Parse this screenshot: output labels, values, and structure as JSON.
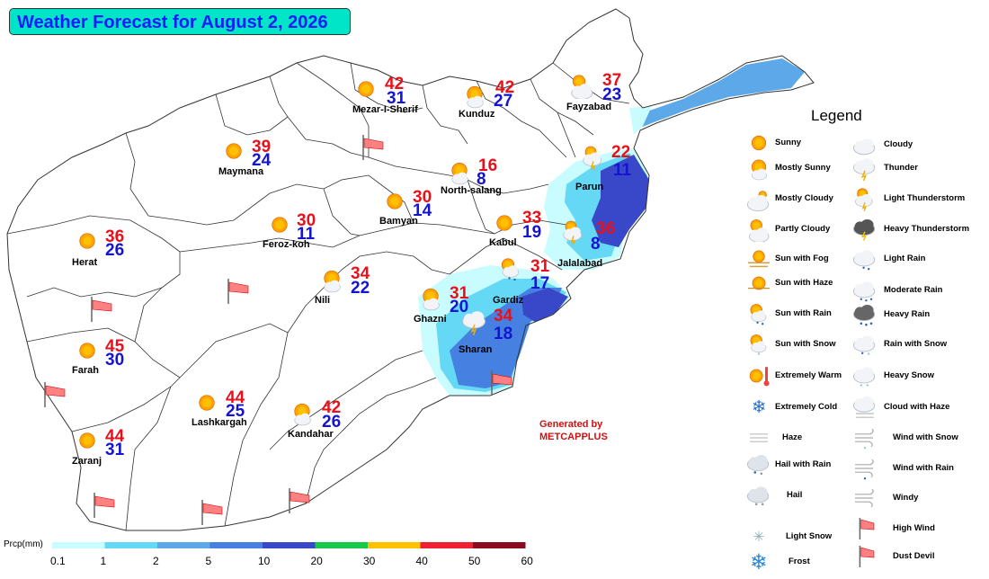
{
  "title": "Weather Forecast for August 2, 2026",
  "cities": [
    {
      "name": "Mezar-I-Sherif",
      "high": "42",
      "low": "31",
      "icon": "sunny-icon"
    },
    {
      "name": "Kunduz",
      "high": "42",
      "low": "27",
      "icon": "mostly-sunny-icon"
    },
    {
      "name": "Fayzabad",
      "high": "37",
      "low": "23",
      "icon": "partly-cloudy-icon"
    },
    {
      "name": "Maymana",
      "high": "39",
      "low": "24",
      "icon": "sunny-icon"
    },
    {
      "name": "North-salang",
      "high": "16",
      "low": "8",
      "icon": "mostly-sunny-icon"
    },
    {
      "name": "Parun",
      "high": "22",
      "low": "11",
      "icon": "light-thunderstorm-icon"
    },
    {
      "name": "Bamyan",
      "high": "30",
      "low": "14",
      "icon": "sunny-icon"
    },
    {
      "name": "Feroz-koh",
      "high": "30",
      "low": "11",
      "icon": "sunny-icon"
    },
    {
      "name": "Kabul",
      "high": "33",
      "low": "19",
      "icon": "sunny-icon"
    },
    {
      "name": "Jalalabad",
      "high": "36",
      "low": "8",
      "icon": "light-thunderstorm-icon"
    },
    {
      "name": "Herat",
      "high": "36",
      "low": "26",
      "icon": "sunny-icon"
    },
    {
      "name": "Nili",
      "high": "34",
      "low": "22",
      "icon": "mostly-sunny-icon"
    },
    {
      "name": "Gardiz",
      "high": "31",
      "low": "17",
      "icon": "sun-with-rain-icon"
    },
    {
      "name": "Ghazni",
      "high": "31",
      "low": "20",
      "icon": "mostly-sunny-icon"
    },
    {
      "name": "Sharan",
      "high": "34",
      "low": "18",
      "icon": "thunder-icon"
    },
    {
      "name": "Farah",
      "high": "45",
      "low": "30",
      "icon": "sunny-icon"
    },
    {
      "name": "Lashkargah",
      "high": "44",
      "low": "25",
      "icon": "sunny-icon"
    },
    {
      "name": "Kandahar",
      "high": "42",
      "low": "26",
      "icon": "mostly-sunny-icon"
    },
    {
      "name": "Zaranj",
      "high": "44",
      "low": "31",
      "icon": "sunny-icon"
    }
  ],
  "legend": {
    "title": "Legend",
    "items": [
      {
        "label": "Sunny",
        "icon": "sunny-icon"
      },
      {
        "label": "Mostly Sunny",
        "icon": "mostly-sunny-icon"
      },
      {
        "label": "Mostly Cloudy",
        "icon": "mostly-cloudy-icon"
      },
      {
        "label": "Partly Cloudy",
        "icon": "partly-cloudy-icon"
      },
      {
        "label": "Sun with Fog",
        "icon": "sun-with-fog-icon"
      },
      {
        "label": "Sun with Haze",
        "icon": "sun-with-haze-icon"
      },
      {
        "label": "Sun with Rain",
        "icon": "sun-with-rain-icon"
      },
      {
        "label": "Sun with Snow",
        "icon": "sun-with-snow-icon"
      },
      {
        "label": "Extremely Warm",
        "icon": "extremely-warm-icon"
      },
      {
        "label": "Extremely Cold",
        "icon": "extremely-cold-icon"
      },
      {
        "label": "Haze",
        "icon": "haze-icon"
      },
      {
        "label": "Hail with Rain",
        "icon": "hail-with-rain-icon"
      },
      {
        "label": "Hail",
        "icon": "hail-icon"
      },
      {
        "label": "Light Snow",
        "icon": "light-snow-icon"
      },
      {
        "label": "Frost",
        "icon": "frost-icon"
      },
      {
        "label": "Cloudy",
        "icon": "cloudy-icon"
      },
      {
        "label": "Thunder",
        "icon": "thunder-icon"
      },
      {
        "label": "Light Thunderstorm",
        "icon": "light-thunderstorm-icon"
      },
      {
        "label": "Heavy Thunderstorm",
        "icon": "heavy-thunderstorm-icon"
      },
      {
        "label": "Light Rain",
        "icon": "light-rain-icon"
      },
      {
        "label": "Moderate Rain",
        "icon": "moderate-rain-icon"
      },
      {
        "label": "Heavy Rain",
        "icon": "heavy-rain-icon"
      },
      {
        "label": "Rain with Snow",
        "icon": "rain-with-snow-icon"
      },
      {
        "label": "Heavy Snow",
        "icon": "heavy-snow-icon"
      },
      {
        "label": "Cloud with Haze",
        "icon": "cloud-with-haze-icon"
      },
      {
        "label": "Wind with Snow",
        "icon": "wind-with-snow-icon"
      },
      {
        "label": "Wind with Rain",
        "icon": "wind-with-rain-icon"
      },
      {
        "label": "Windy",
        "icon": "windy-icon"
      },
      {
        "label": "High Wind",
        "icon": "high-wind-icon"
      },
      {
        "label": "Dust Devil",
        "icon": "dust-devil-icon"
      }
    ]
  },
  "credit": {
    "line1": "Generated by",
    "line2": "METCAPPLUS"
  },
  "precip_scale": {
    "label": "Prcp(mm)",
    "ticks": [
      "0.1",
      "1",
      "2",
      "5",
      "10",
      "20",
      "30",
      "40",
      "50",
      "60"
    ],
    "colors": [
      "#c8fcff",
      "#64d8f5",
      "#5ca8e8",
      "#4680e0",
      "#3848c8",
      "#18c848",
      "#ffc000",
      "#f02030",
      "#8a0a20"
    ]
  }
}
